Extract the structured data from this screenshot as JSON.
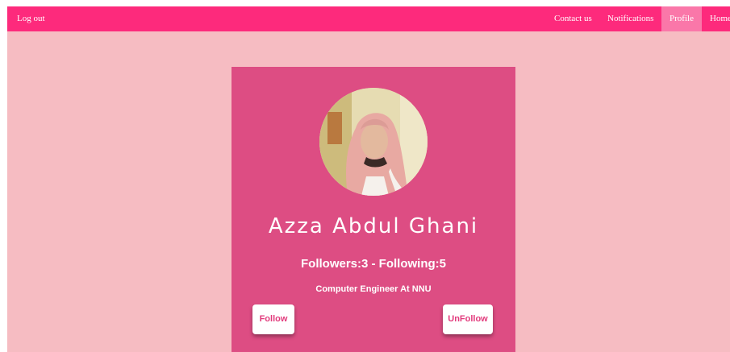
{
  "navbar": {
    "logout": "Log out",
    "contact": "Contact us",
    "notifications": "Notifications",
    "profile": "Profile",
    "home": "Home"
  },
  "profile": {
    "name": "Azza Abdul Ghani",
    "stats": "Followers:3 - Following:5",
    "bio": "Computer Engineer At NNU",
    "follow_label": "Follow",
    "unfollow_label": "UnFollow"
  },
  "colors": {
    "navbar": "#fd2a7c",
    "active_tab": "#fa77a9",
    "page_background": "#f6bcc2",
    "card": "#dd4d83",
    "button_text": "#e23a7c"
  }
}
